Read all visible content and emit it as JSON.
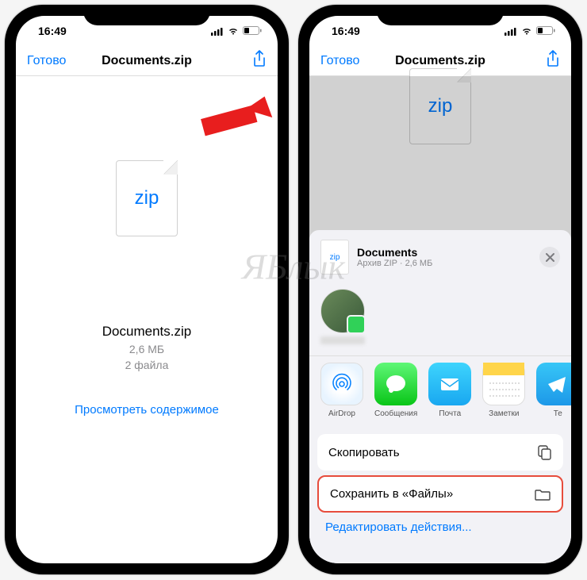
{
  "status": {
    "time": "16:49"
  },
  "nav": {
    "done": "Готово",
    "title": "Documents.zip"
  },
  "file": {
    "ext": "zip",
    "name": "Documents.zip",
    "size": "2,6 МБ",
    "count": "2 файла",
    "view": "Просмотреть содержимое"
  },
  "sheet": {
    "title": "Documents",
    "sub": "Архив ZIP · 2,6 МБ",
    "apps": {
      "airdrop": "AirDrop",
      "messages": "Сообщения",
      "mail": "Почта",
      "notes": "Заметки",
      "tel": "Те"
    },
    "actions": {
      "copy": "Скопировать",
      "save": "Сохранить в «Файлы»",
      "edit": "Редактировать действия..."
    }
  },
  "watermark": "ЯБлык"
}
